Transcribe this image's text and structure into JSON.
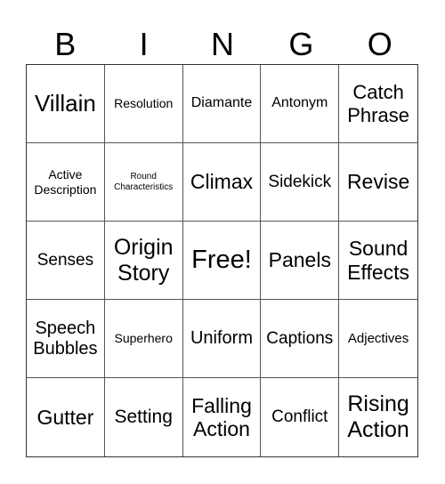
{
  "header": {
    "letters": [
      "B",
      "I",
      "N",
      "G",
      "O"
    ]
  },
  "cells": [
    [
      "Villain",
      "Resolution",
      "Diamante",
      "Antonym",
      "Catch Phrase"
    ],
    [
      "Active Description",
      "Round Characteristics",
      "Climax",
      "Sidekick",
      "Revise"
    ],
    [
      "Senses",
      "Origin Story",
      "Free!",
      "Panels",
      "Sound Effects"
    ],
    [
      "Speech Bubbles",
      "Superhero",
      "Uniform",
      "Captions",
      "Adjectives"
    ],
    [
      "Gutter",
      "Setting",
      "Falling Action",
      "Conflict",
      "Rising Action"
    ]
  ],
  "free_space": {
    "row": 2,
    "col": 2,
    "label": "Free!"
  }
}
